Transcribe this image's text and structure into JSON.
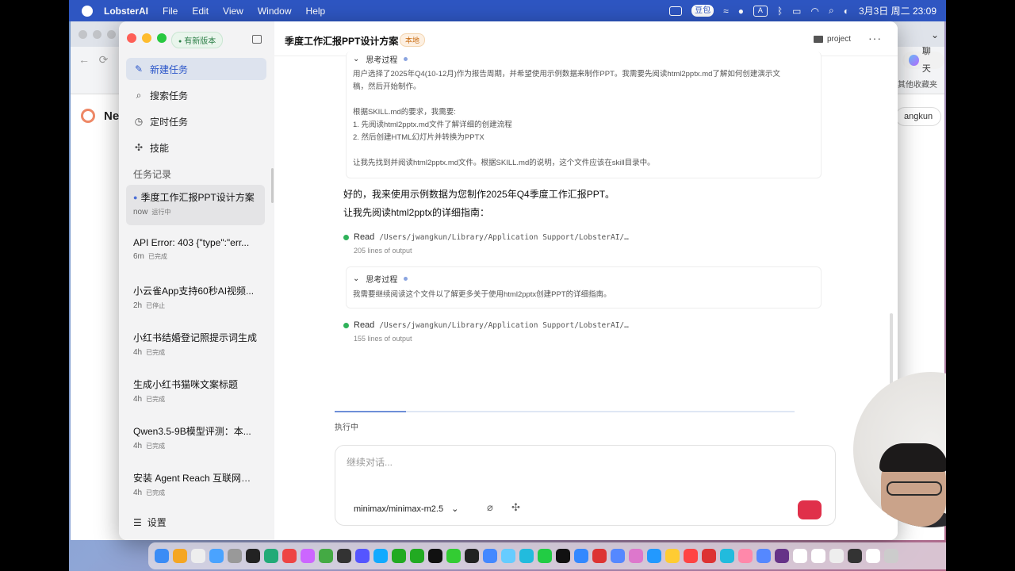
{
  "menubar": {
    "app_name": "LobsterAI",
    "menus": [
      "File",
      "Edit",
      "View",
      "Window",
      "Help"
    ],
    "ime_label": "豆包",
    "ime_letter": "A",
    "datetime": "3月3日 周二 23:09"
  },
  "browser": {
    "brand_partial": "Ne",
    "chat_label": "聊天",
    "bookmarks_label": "其他收藏夹",
    "user_partial": "angkun"
  },
  "sidebar": {
    "new_version_label": "有新版本",
    "nav": [
      {
        "label": "新建任务",
        "icon": "edit-icon"
      },
      {
        "label": "搜索任务",
        "icon": "search-icon"
      },
      {
        "label": "定时任务",
        "icon": "clock-icon"
      },
      {
        "label": "技能",
        "icon": "puzzle-icon"
      }
    ],
    "section_title": "任务记录",
    "tasks": [
      {
        "title": "季度工作汇报PPT设计方案",
        "time": "now",
        "status": "运行中"
      },
      {
        "title": "API Error: 403 {\"type\":\"err...",
        "time": "6m",
        "status": "已完成"
      },
      {
        "title": "小云雀App支持60秒AI视频...",
        "time": "2h",
        "status": "已停止"
      },
      {
        "title": "小红书结婚登记照提示词生成",
        "time": "4h",
        "status": "已完成"
      },
      {
        "title": "生成小红书猫咪文案标题",
        "time": "4h",
        "status": "已完成"
      },
      {
        "title": "Qwen3.5-9B模型评测：本...",
        "time": "4h",
        "status": "已完成"
      },
      {
        "title": "安装 Agent Reach 互联网能...",
        "time": "4h",
        "status": "已完成"
      }
    ],
    "settings_label": "设置"
  },
  "header": {
    "title": "季度工作汇报PPT设计方案",
    "badge": "本地",
    "folder": "project"
  },
  "conversation": {
    "thinking1": {
      "label": "思考过程",
      "lines": [
        "用户选择了2025年Q4(10-12月)作为报告周期，并希望使用示例数据来制作PPT。我需要先阅读html2pptx.md了解如何创建演示文",
        "稿，然后开始制作。",
        "",
        "根据SKILL.md的要求，我需要:",
        "1. 先阅读html2pptx.md文件了解详细的创建流程",
        "2. 然后创建HTML幻灯片并转换为PPTX",
        "",
        "让我先找到并阅读html2pptx.md文件。根据SKILL.md的说明，这个文件应该在skill目录中。"
      ]
    },
    "assistant_message": [
      "好的，我来使用示例数据为您制作2025年Q4季度工作汇报PPT。",
      "让我先阅读html2pptx的详细指南："
    ],
    "tool1": {
      "name": "Read",
      "path": "/Users/jwangkun/Library/Application Support/LobsterAI/…",
      "output": "205 lines of output"
    },
    "thinking2": {
      "label": "思考过程",
      "text": "我需要继续阅读这个文件以了解更多关于使用html2pptx创建PPT的详细指南。"
    },
    "tool2": {
      "name": "Read",
      "path": "/Users/jwangkun/Library/Application Support/LobsterAI/…",
      "output": "155 lines of output"
    }
  },
  "progress": {
    "fraction": 0.155
  },
  "status_label": "执行中",
  "composer": {
    "placeholder": "继续对话...",
    "model": "minimax/minimax-m2.5"
  },
  "colors": {
    "accent": "#2b56c9",
    "running_dot": "#2fb25a",
    "send_button": "#e0304a",
    "badge_text": "#c86a10"
  }
}
